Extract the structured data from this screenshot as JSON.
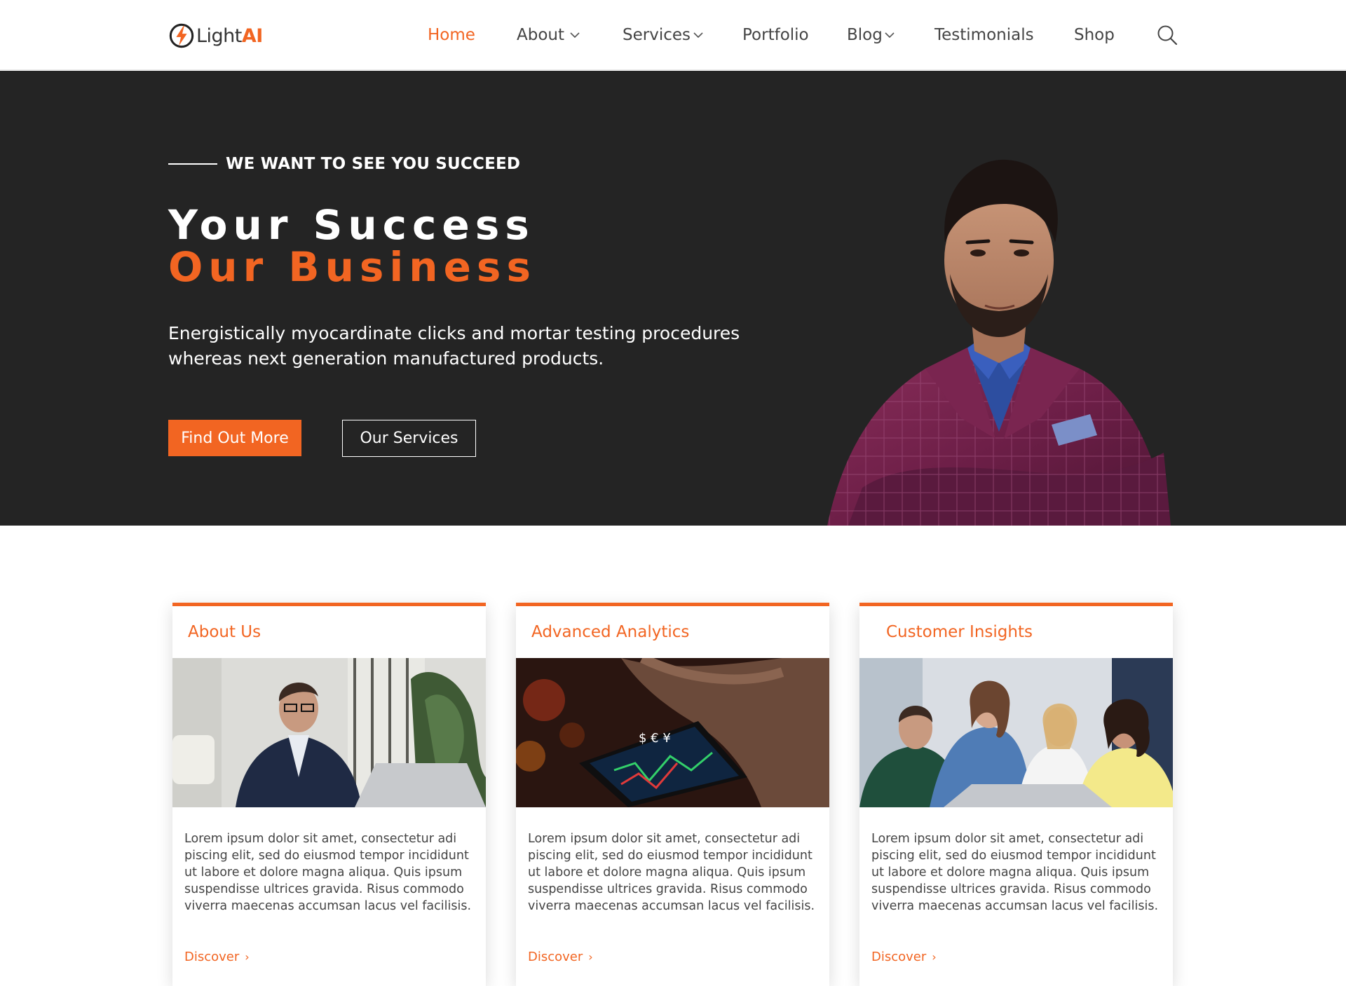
{
  "brand": {
    "name_part1": "Light",
    "name_part2": "AI",
    "accent_color": "#f26522"
  },
  "nav": {
    "items": [
      {
        "label": "Home",
        "active": true,
        "has_dropdown": false
      },
      {
        "label": "About",
        "active": false,
        "has_dropdown": true
      },
      {
        "label": "Services",
        "active": false,
        "has_dropdown": true
      },
      {
        "label": "Portfolio",
        "active": false,
        "has_dropdown": false
      },
      {
        "label": "Blog",
        "active": false,
        "has_dropdown": true
      },
      {
        "label": "Testimonials",
        "active": false,
        "has_dropdown": false
      },
      {
        "label": "Shop",
        "active": false,
        "has_dropdown": false
      }
    ],
    "search_icon": "search-icon"
  },
  "hero": {
    "eyebrow": "WE WANT TO SEE YOU SUCCEED",
    "headline_line1": "Your Success",
    "headline_line2": "Our Business",
    "description": "Energistically myocardinate clicks and mortar testing procedures whereas next generation manufactured products.",
    "primary_button": "Find Out More",
    "secondary_button": "Our Services",
    "background_color": "#242424"
  },
  "cards": [
    {
      "title": "About Us",
      "image": "businessman-with-laptop",
      "text": "Lorem ipsum dolor sit amet, consectetur adi piscing elit, sed do eiusmod tempor incididunt ut labore et dolore magna aliqua. Quis ipsum suspendisse ultrices gravida. Risus commodo viverra maecenas accumsan lacus vel facilisis.",
      "link": "Discover"
    },
    {
      "title": "Advanced Analytics",
      "image": "hand-with-smartphone-chart",
      "text": "Lorem ipsum dolor sit amet, consectetur adi piscing elit, sed do eiusmod tempor incididunt ut labore et dolore magna aliqua. Quis ipsum suspendisse ultrices gravida. Risus commodo viverra maecenas accumsan lacus vel facilisis.",
      "link": "Discover"
    },
    {
      "title": "Customer Insights",
      "image": "team-around-laptop",
      "text": "Lorem ipsum dolor sit amet, consectetur adi piscing elit, sed do eiusmod tempor incididunt ut labore et dolore magna aliqua. Quis ipsum suspendisse ultrices gravida. Risus commodo viverra maecenas accumsan lacus vel facilisis.",
      "link": "Discover"
    }
  ]
}
